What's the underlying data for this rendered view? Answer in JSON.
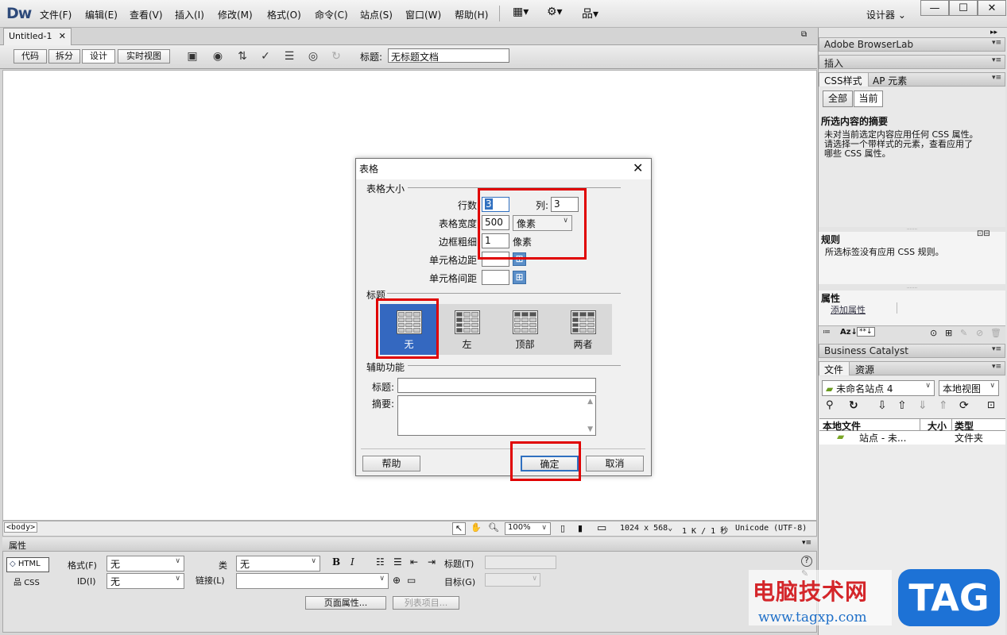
{
  "app": {
    "logo": "Dw",
    "workspace": "设计器 ⌄"
  },
  "menu": [
    "文件(F)",
    "编辑(E)",
    "查看(V)",
    "插入(I)",
    "修改(M)",
    "格式(O)",
    "命令(C)",
    "站点(S)",
    "窗口(W)",
    "帮助(H)"
  ],
  "doc": {
    "tab": "Untitled-1",
    "views": [
      "代码",
      "拆分",
      "设计",
      "实时视图"
    ],
    "title_label": "标题:",
    "title_value": "无标题文档"
  },
  "status": {
    "tag": "<body>",
    "zoom": "100%",
    "size": "1024 x 568⌄",
    "info": "1 K / 1 秒",
    "encoding": "Unicode (UTF-8)"
  },
  "props": {
    "header": "属性",
    "html_btn": "HTML",
    "css_btn": "CSS",
    "format_label": "格式(F)",
    "format_value": "无",
    "id_label": "ID(I)",
    "id_value": "无",
    "class_label": "类",
    "class_value": "无",
    "link_label": "链接(L)",
    "title_label": "标题(T)",
    "target_label": "目标(G)",
    "page_props": "页面属性...",
    "list_items": "列表项目..."
  },
  "right": {
    "browserlab": "Adobe BrowserLab",
    "insert": "插入",
    "css_tab": "CSS样式",
    "ap_tab": "AP 元素",
    "all": "全部",
    "current": "当前",
    "summary_title": "所选内容的摘要",
    "summary_text": [
      "未对当前选定内容应用任何 CSS 属性。",
      "请选择一个带样式的元素，查看应用了",
      "哪些 CSS 属性。"
    ],
    "rules_title": "规则",
    "rules_text": "所选标签没有应用 CSS 规则。",
    "attr_title": "属性",
    "add_attr": "添加属性",
    "bc": "Business Catalyst",
    "files_tab": "文件",
    "assets_tab": "资源",
    "site": "未命名站点 4",
    "view": "本地视图",
    "cols": [
      "本地文件",
      "大小",
      "类型"
    ],
    "row": {
      "name": "站点 - 未...",
      "type": "文件夹"
    }
  },
  "dialog": {
    "title": "表格",
    "size_group": "表格大小",
    "rows_label": "行数",
    "rows_value": "3",
    "cols_label": "列:",
    "cols_value": "3",
    "width_label": "表格宽度",
    "width_value": "500",
    "width_unit": "像素",
    "border_label": "边框粗细",
    "border_value": "1",
    "border_unit": "像素",
    "padding_label": "单元格边距",
    "spacing_label": "单元格间距",
    "header_group": "标题",
    "header_opts": [
      "无",
      "左",
      "顶部",
      "两者"
    ],
    "access_group": "辅助功能",
    "caption_label": "标题:",
    "summary_label": "摘要:",
    "help": "帮助",
    "ok": "确定",
    "cancel": "取消"
  },
  "watermark": {
    "text": "电脑技术网",
    "url": "www.tagxp.com",
    "badge": "TAG"
  }
}
